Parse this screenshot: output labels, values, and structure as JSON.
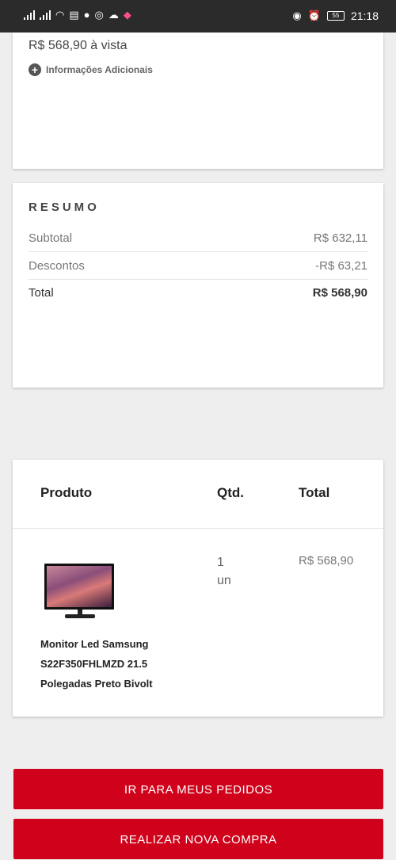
{
  "status_bar": {
    "left_icons": [
      "signal-icon",
      "signal-icon",
      "wifi-icon",
      "message-icon",
      "whatsapp-icon",
      "instagram-icon",
      "cloud-icon",
      "app-icon"
    ],
    "battery": "55",
    "time": "21:18"
  },
  "payment": {
    "price_line": "R$ 568,90 à vista",
    "info_label": "Informações Adicionais"
  },
  "summary": {
    "title": "RESUMO",
    "subtotal_label": "Subtotal",
    "subtotal_value": "R$ 632,11",
    "discount_label": "Descontos",
    "discount_value": "-R$ 63,21",
    "total_label": "Total",
    "total_value": "R$ 568,90"
  },
  "order_table": {
    "headers": [
      "Produto",
      "Qtd.",
      "Total"
    ],
    "item": {
      "name_lines": [
        "Monitor Led Samsung",
        "S22F350FHLMZD 21.5",
        "Polegadas Preto Bivolt"
      ],
      "qty_value": "1",
      "qty_unit": "un",
      "total": "R$ 568,90"
    }
  },
  "actions": {
    "primary": "IR PARA MEUS PEDIDOS",
    "secondary": "REALIZAR NOVA COMPRA"
  },
  "colors": {
    "accent": "#d0021b",
    "status_bar": "#2b2b2b",
    "background": "#eeeeee"
  }
}
